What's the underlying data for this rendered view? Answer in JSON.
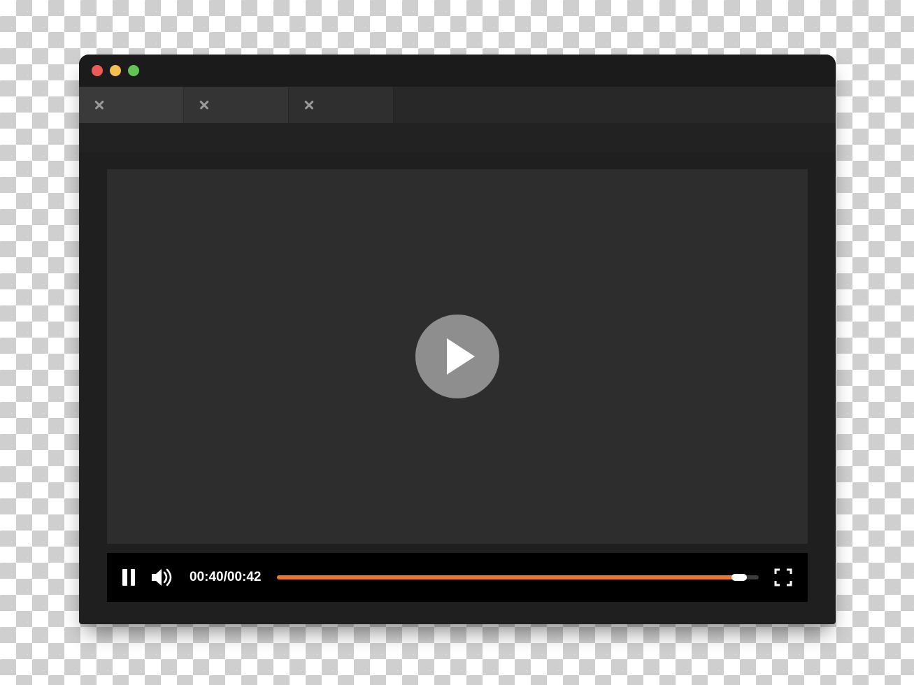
{
  "window": {
    "traffic_lights": [
      "close",
      "minimize",
      "maximize"
    ],
    "tabs": [
      {
        "close_icon": "close-icon"
      },
      {
        "close_icon": "close-icon"
      },
      {
        "close_icon": "close-icon"
      }
    ]
  },
  "player": {
    "center_button_icon": "play-icon",
    "controls": {
      "pause_icon": "pause-icon",
      "volume_icon": "volume-icon",
      "time_current": "00:40",
      "time_separator": "/",
      "time_total": "00:42",
      "progress_percent": 96,
      "fullscreen_icon": "fullscreen-icon"
    }
  },
  "colors": {
    "accent": "#e8762c",
    "window_bg": "#1f1f1f",
    "video_bg": "#2d2d2d",
    "control_bg": "#000000"
  }
}
